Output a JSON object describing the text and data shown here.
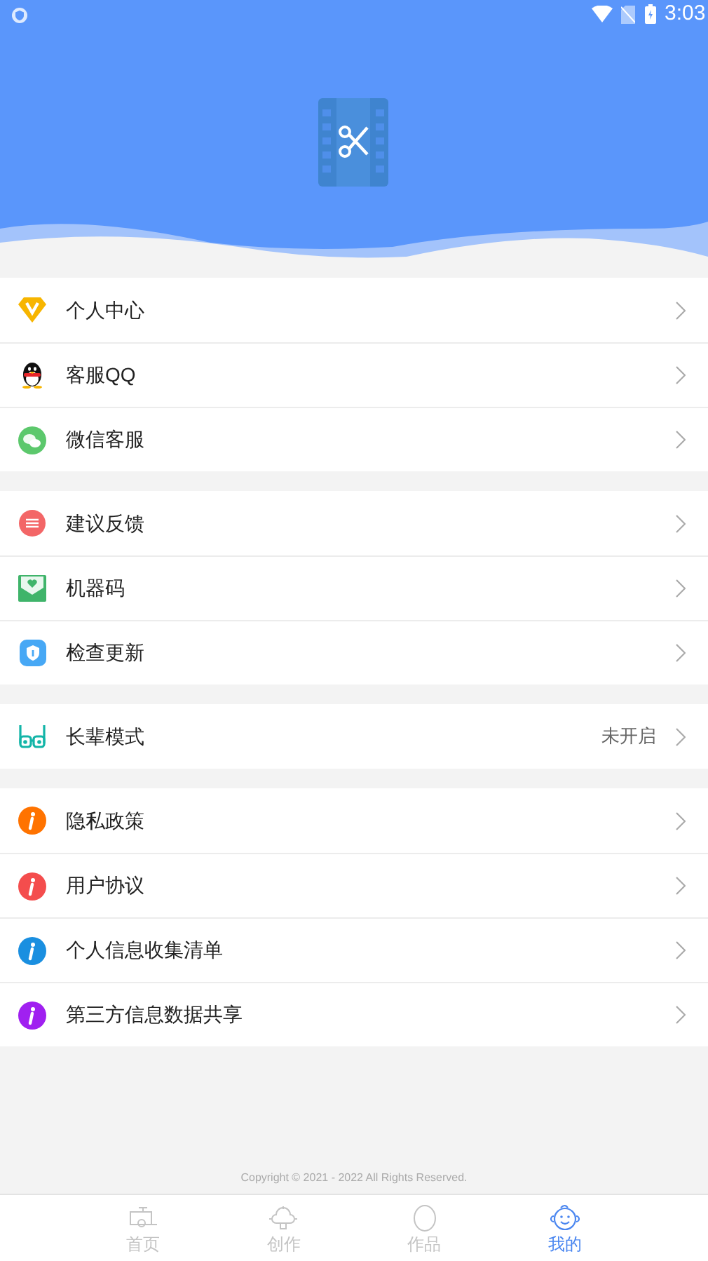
{
  "status_bar": {
    "time": "3:03"
  },
  "sections": [
    {
      "items": [
        {
          "kind": "vip",
          "label": "个人中心"
        },
        {
          "kind": "qq",
          "label": "客服QQ"
        },
        {
          "kind": "wechat",
          "label": "微信客服"
        }
      ]
    },
    {
      "items": [
        {
          "kind": "feedback",
          "label": "建议反馈"
        },
        {
          "kind": "machine",
          "label": "机器码"
        },
        {
          "kind": "update",
          "label": "检查更新"
        }
      ]
    },
    {
      "items": [
        {
          "kind": "glasses",
          "label": "长辈模式",
          "value": "未开启"
        }
      ]
    },
    {
      "items": [
        {
          "kind": "info",
          "color": "#ff7300",
          "label": "隐私政策"
        },
        {
          "kind": "info",
          "color": "#f44d4d",
          "label": "用户协议"
        },
        {
          "kind": "info",
          "color": "#1a8fe0",
          "label": "个人信息收集清单"
        },
        {
          "kind": "info",
          "color": "#a020f0",
          "label": "第三方信息数据共享"
        }
      ]
    }
  ],
  "copyright": "Copyright © 2021 - 2022 All Rights Reserved.",
  "tabs": [
    {
      "kind": "home",
      "label": "首页",
      "selected": false
    },
    {
      "kind": "create",
      "label": "创作",
      "selected": false
    },
    {
      "kind": "works",
      "label": "作品",
      "selected": false
    },
    {
      "kind": "me",
      "label": "我的",
      "selected": true
    }
  ]
}
